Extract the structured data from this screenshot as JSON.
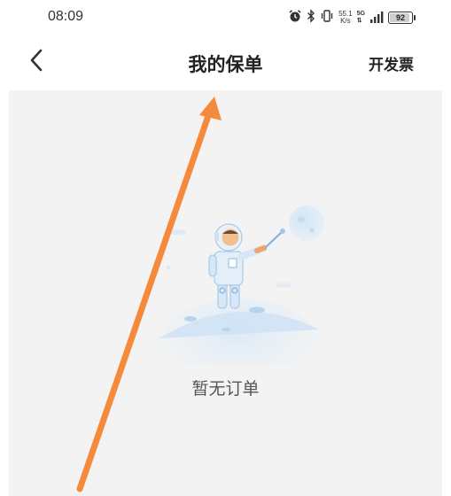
{
  "status_bar": {
    "time": "08:09",
    "net_speed_value": "55.1",
    "net_speed_unit": "K/s",
    "network_type": "5G",
    "battery_level": "92",
    "battery_percent": 92,
    "icons": [
      "alarm-icon",
      "bluetooth-icon",
      "vibrate-icon",
      "signal-icon",
      "battery-icon"
    ]
  },
  "nav": {
    "title": "我的保单",
    "right_action": "开发票",
    "back_icon": "chevron-left-icon"
  },
  "empty_state": {
    "message": "暂无订单",
    "illustration": "astronaut-on-moon-illustration"
  },
  "annotation": {
    "icon": "arrow-annotation",
    "color": "#f58a3c"
  },
  "colors": {
    "panel_background": "#f3f3f3",
    "illustration_blue": "#bcd9f3",
    "accent_orange": "#f58a3c"
  }
}
